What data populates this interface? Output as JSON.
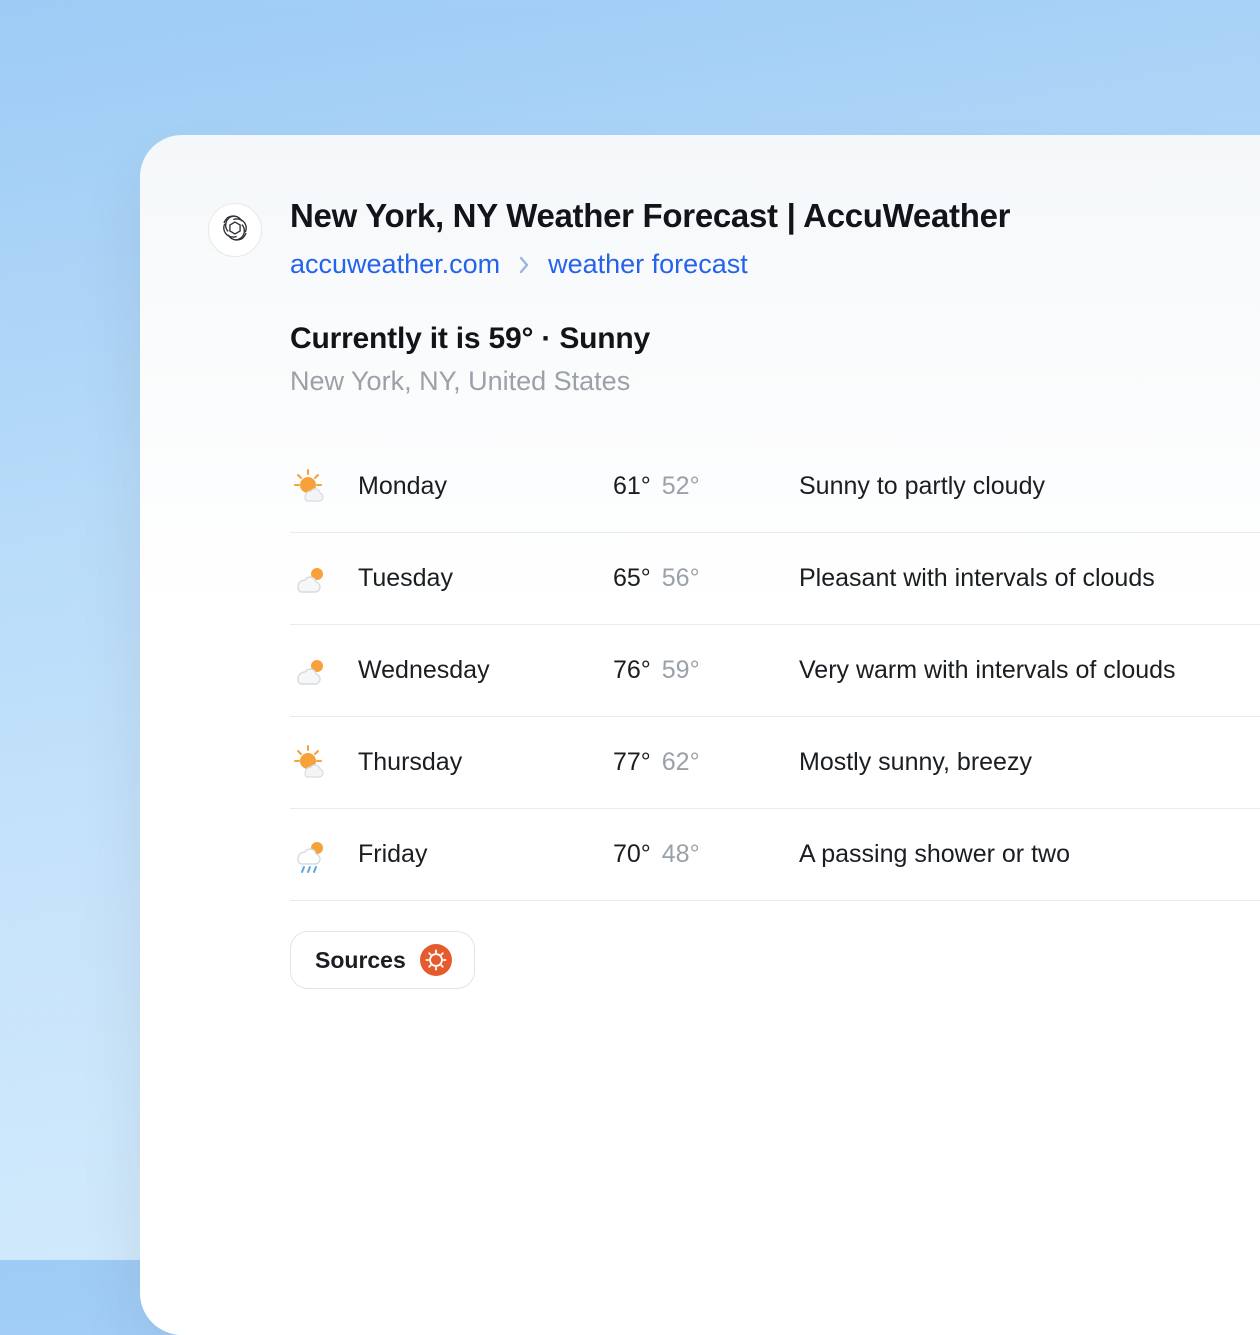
{
  "header": {
    "title": "New York, NY Weather Forecast | AccuWeather",
    "breadcrumb_domain": "accuweather.com",
    "breadcrumb_section": "weather forecast"
  },
  "current": {
    "line": "Currently it is 59° · Sunny",
    "location": "New York, NY, United States"
  },
  "forecast": [
    {
      "icon": "sun-cloud",
      "day": "Monday",
      "hi": "61°",
      "lo": "52°",
      "desc": "Sunny to partly cloudy"
    },
    {
      "icon": "cloud-sun",
      "day": "Tuesday",
      "hi": "65°",
      "lo": "56°",
      "desc": "Pleasant with intervals of clouds"
    },
    {
      "icon": "cloud-sun",
      "day": "Wednesday",
      "hi": "76°",
      "lo": "59°",
      "desc": "Very warm with intervals of clouds"
    },
    {
      "icon": "sun-cloud",
      "day": "Thursday",
      "hi": "77°",
      "lo": "62°",
      "desc": "Mostly sunny, breezy"
    },
    {
      "icon": "cloud-rain",
      "day": "Friday",
      "hi": "70°",
      "lo": "48°",
      "desc": "A passing shower or two"
    }
  ],
  "sources": {
    "label": "Sources"
  }
}
